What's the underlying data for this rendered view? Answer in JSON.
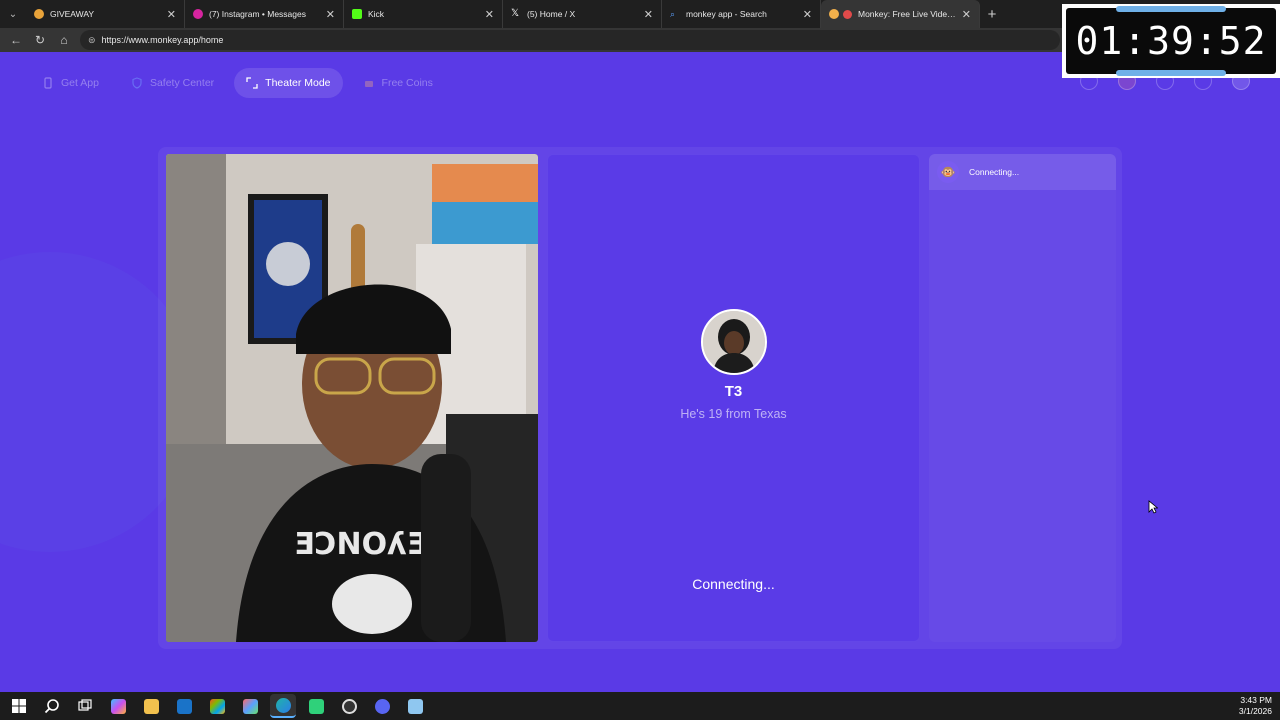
{
  "browser": {
    "tabs": [
      {
        "label": "GIVEAWAY",
        "favicon_color": "#e8a33a",
        "active": false
      },
      {
        "label": "(7) Instagram • Messages",
        "favicon_color": "#d6249f",
        "active": false
      },
      {
        "label": "Kick",
        "favicon_color": "#53fc18",
        "active": false
      },
      {
        "label": "(5) Home / X",
        "favicon_color": "#ffffff",
        "active": false
      },
      {
        "label": "monkey app - Search",
        "favicon_color": "#5a9cf8",
        "active": false
      },
      {
        "label": "Monkey: Free Live Video Chat",
        "favicon_color": "#f2b04b",
        "active": true
      }
    ],
    "url": "https://www.monkey.app/home"
  },
  "topnav": {
    "items": [
      {
        "label": "Get App",
        "icon": "phone-icon"
      },
      {
        "label": "Safety Center",
        "icon": "shield-icon"
      },
      {
        "label": "Theater Mode",
        "icon": "expand-icon"
      },
      {
        "label": "Free Coins",
        "icon": "coins-icon"
      }
    ]
  },
  "remote": {
    "name": "T3",
    "description": "He's 19 from Texas",
    "status": "Connecting..."
  },
  "chat": {
    "status": "Connecting..."
  },
  "overlay": {
    "timer": "01:39:52"
  },
  "taskbar": {
    "time": "3:43 PM",
    "date": "3/1/2026"
  },
  "colors": {
    "page_bg": "#5a3ae6",
    "accent_blue": "#6fb0e8"
  }
}
